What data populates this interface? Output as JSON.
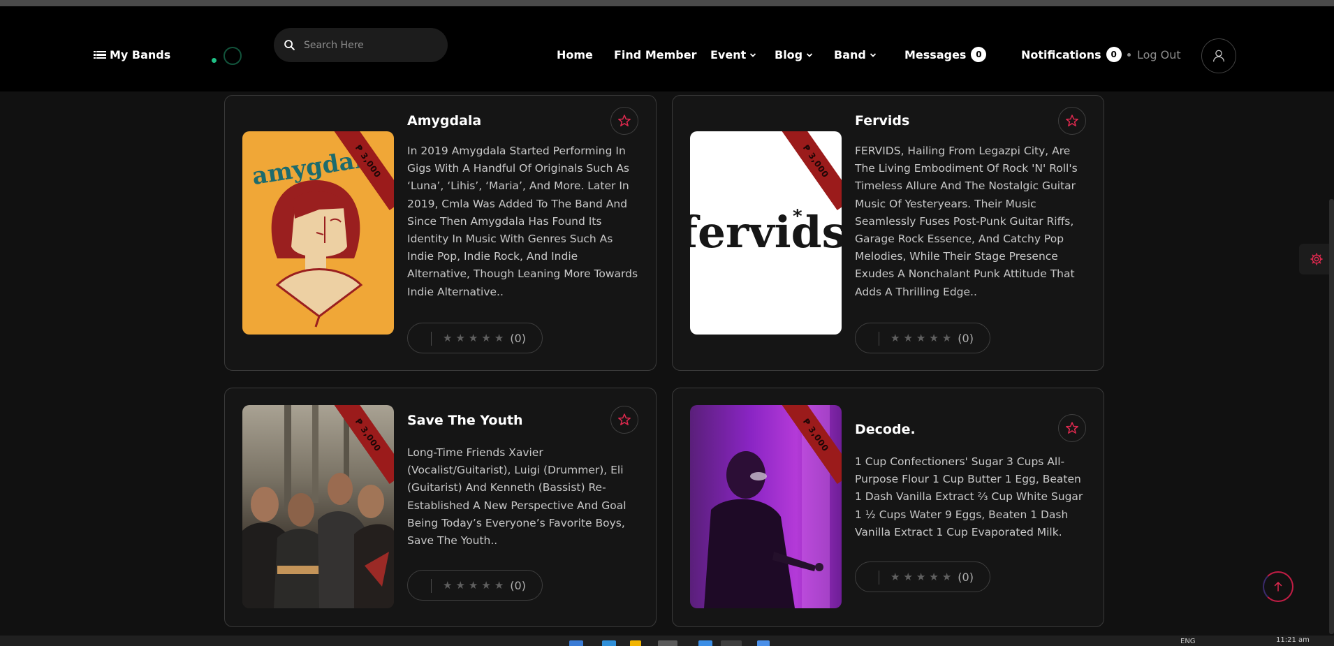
{
  "header": {
    "brand_label": "My Bands",
    "search_placeholder": "Search Here",
    "nav": {
      "home": "Home",
      "find_member": "Find Member",
      "event": "Event",
      "blog": "Blog",
      "band": "Band",
      "messages": "Messages",
      "messages_count": "0",
      "notifications": "Notifications",
      "notifications_count": "0",
      "logout": "Log Out"
    }
  },
  "bands": [
    {
      "name": "Amygdala",
      "price": "₱ 3,000",
      "logo_text": "amygdala",
      "description": "In 2019 Amygdala Started Performing In Gigs With A Handful Of Originals Such As ‘Luna’, ‘Lihis’, ‘Maria’, And More. Later In 2019, Cmla Was Added To The Band And Since Then Amygdala Has Found Its Identity In Music With Genres Such As Indie Pop, Indie Rock, And Indie Alternative, Though Leaning More Towards Indie Alternative..",
      "rating_count": "(0)"
    },
    {
      "name": "Fervids",
      "price": "₱ 3,000",
      "logo_text": "fervids",
      "description": "FERVIDS, Hailing From Legazpi City, Are The Living Embodiment Of Rock 'N' Roll's Timeless Allure And The Nostalgic Guitar Music Of Yesteryears. Their Music Seamlessly Fuses Post-Punk Guitar Riffs, Garage Rock Essence, And Catchy Pop Melodies, While Their Stage Presence Exudes A Nonchalant Punk Attitude That Adds A Thrilling Edge..",
      "rating_count": "(0)"
    },
    {
      "name": "Save The Youth",
      "price": "₱ 3,000",
      "description": "Long-Time Friends Xavier (Vocalist/Guitarist), Luigi (Drummer), Eli (Guitarist) And Kenneth (Bassist) Re-Established A New Perspective And Goal Being Today’s Everyone’s Favorite Boys, Save The Youth..",
      "rating_count": "(0)"
    },
    {
      "name": "Decode.",
      "price": "₱ 3,000",
      "description": "1 Cup Confectioners' Sugar 3 Cups All-Purpose Flour 1 Cup Butter 1 Egg, Beaten 1 Dash Vanilla Extract ⅔ Cup White Sugar 1 ½ Cups Water 9 Eggs, Beaten 1 Dash Vanilla Extract 1 Cup Evaporated Milk.",
      "rating_count": "(0)"
    }
  ],
  "taskbar": {
    "lang": "ENG",
    "time": "11:21 am"
  },
  "colors": {
    "accent_red": "#e0294f",
    "ribbon": "#9b1b1b",
    "background": "#111111",
    "navbar": "#000000"
  }
}
